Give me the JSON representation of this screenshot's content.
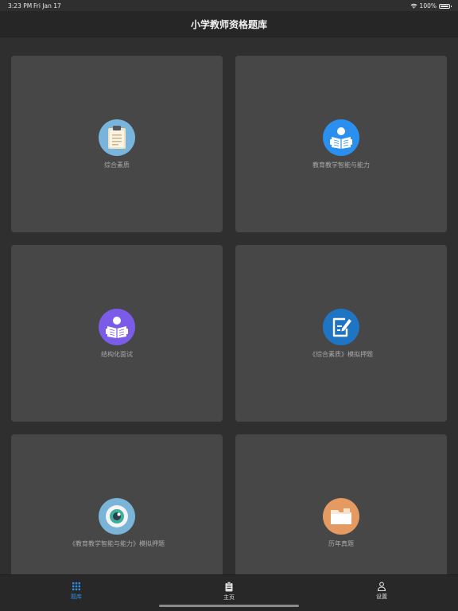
{
  "status": {
    "time": "3:23 PM",
    "date": "Fri Jan 17",
    "battery": "100%"
  },
  "header": {
    "title": "小学教师资格题库"
  },
  "cards": [
    {
      "label": "综合素质",
      "icon": "clipboard-icon",
      "color": "#78b4dc"
    },
    {
      "label": "教育教学智能与能力",
      "icon": "reading-person-icon",
      "color": "#2b8ff0"
    },
    {
      "label": "结构化面试",
      "icon": "reading-person-icon",
      "color": "#7b5ce8"
    },
    {
      "label": "《综合素质》模拟押题",
      "icon": "edit-document-icon",
      "color": "#1f74c4"
    },
    {
      "label": "《教育教学智能与能力》模拟押题",
      "icon": "eye-icon",
      "color": "#7ab4d8"
    },
    {
      "label": "历年真题",
      "icon": "folder-icon",
      "color": "#e49a60"
    }
  ],
  "tabs": [
    {
      "label": "题库",
      "icon": "grid-icon",
      "active": true
    },
    {
      "label": "主页",
      "icon": "clipboard-icon",
      "active": false
    },
    {
      "label": "设置",
      "icon": "person-icon",
      "active": false
    }
  ]
}
